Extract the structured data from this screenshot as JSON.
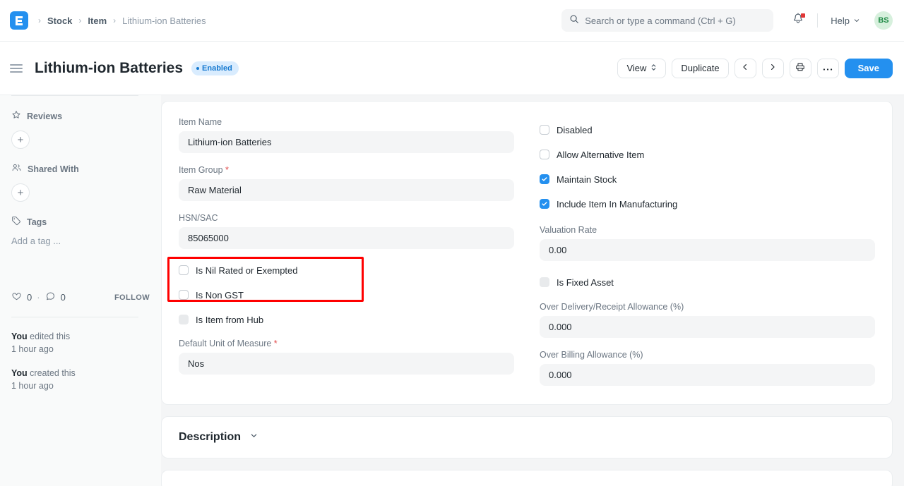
{
  "navbar": {
    "logo_alt": "erpnext-logo",
    "breadcrumb": [
      {
        "label": "Stock"
      },
      {
        "label": "Item"
      },
      {
        "label": "Lithium-ion Batteries"
      }
    ],
    "separator": "›",
    "search": {
      "placeholder": "Search or type a command (Ctrl + G)",
      "value": ""
    },
    "help_label": "Help",
    "avatar_initials": "BS"
  },
  "page_head": {
    "title": "Lithium-ion Batteries",
    "status_badge": "Enabled",
    "actions": {
      "view": "View",
      "duplicate": "Duplicate",
      "prev": "‹",
      "next": "›",
      "save": "Save"
    }
  },
  "sidebar": {
    "reviews_label": "Reviews",
    "reviews_add": "+",
    "shared_with_label": "Shared With",
    "shared_with_add": "+",
    "tags_label": "Tags",
    "tags_placeholder": "Add a tag ...",
    "like_count": "0",
    "dot_sep": "·",
    "comment_count": "0",
    "follow_label": "FOLLOW",
    "activity": [
      {
        "actor": "You",
        "action": " edited this",
        "time": "1 hour ago"
      },
      {
        "actor": "You",
        "action": " created this",
        "time": "1 hour ago"
      }
    ]
  },
  "form": {
    "left": {
      "item_name_label": "Item Name",
      "item_name_value": "Lithium-ion Batteries",
      "item_group_label": "Item Group",
      "item_group_value": "Raw Material",
      "hsn_label": "HSN/SAC",
      "hsn_value": "85065000",
      "cb_nil_rated": "Is Nil Rated or Exempted",
      "cb_non_gst": "Is Non GST",
      "cb_item_from_hub": "Is Item from Hub",
      "uom_label": "Default Unit of Measure",
      "uom_value": "Nos"
    },
    "right": {
      "cb_disabled": "Disabled",
      "cb_allow_alt": "Allow Alternative Item",
      "cb_maintain_stock": "Maintain Stock",
      "cb_include_manufacturing": "Include Item In Manufacturing",
      "valuation_rate_label": "Valuation Rate",
      "valuation_rate_value": "0.00",
      "cb_fixed_asset": "Is Fixed Asset",
      "over_delivery_label": "Over Delivery/Receipt Allowance (%)",
      "over_delivery_value": "0.000",
      "over_billing_label": "Over Billing Allowance (%)",
      "over_billing_value": "0.000"
    }
  },
  "description_section": {
    "title": "Description"
  },
  "colors": {
    "accent": "#2490ef",
    "badge_bg": "#d9ecfe",
    "badge_text": "#1579d0",
    "highlight": "#ff0000",
    "required": "#e24c4c",
    "avatar_bg": "#d7f0dd",
    "avatar_text": "#1f8a45"
  }
}
